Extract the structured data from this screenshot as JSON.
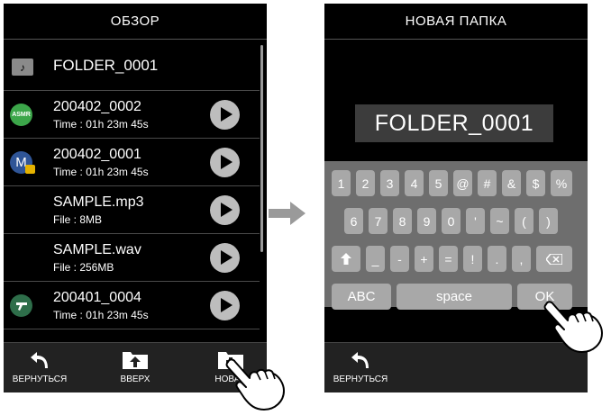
{
  "left": {
    "title": "ОБЗОР",
    "items": [
      {
        "kind": "folder",
        "name": "FOLDER_0001",
        "meta": ""
      },
      {
        "kind": "file",
        "name": "200402_0002",
        "meta": "Time : 01h 23m 45s",
        "icon": "ASMR"
      },
      {
        "kind": "file",
        "name": "200402_0001",
        "meta": "Time : 01h 23m 45s",
        "icon": "M"
      },
      {
        "kind": "file",
        "name": "SAMPLE.mp3",
        "meta": "File : 8MB",
        "icon": ""
      },
      {
        "kind": "file",
        "name": "SAMPLE.wav",
        "meta": "File : 256MB",
        "icon": ""
      },
      {
        "kind": "file",
        "name": "200401_0004",
        "meta": "Time : 01h 23m 45s",
        "icon": ""
      }
    ],
    "bottom": {
      "back": "ВЕРНУТЬСЯ",
      "up": "ВВЕРХ",
      "new": "НОВАЯ"
    }
  },
  "right": {
    "title": "НОВАЯ ПАПКА",
    "folder_name": "FOLDER_0001",
    "keys_row1": [
      "1",
      "2",
      "3",
      "4",
      "5",
      "@",
      "#",
      "&",
      "$",
      "%"
    ],
    "keys_row2": [
      "6",
      "7",
      "8",
      "9",
      "0",
      "'",
      "~",
      "(",
      ")"
    ],
    "keys_row3": [
      "_",
      "-",
      "+",
      "=",
      "!",
      ".",
      ","
    ],
    "abc": "ABC",
    "space": "space",
    "ok": "OK",
    "bottom": {
      "back": "ВЕРНУТЬСЯ"
    }
  },
  "icons": {
    "folder": "folder-icon",
    "play": "play-icon",
    "back": "back-arrow-icon",
    "up": "folder-up-icon",
    "new": "new-folder-icon",
    "shift": "shift-icon",
    "backspace": "backspace-icon",
    "hand": "pointing-hand-icon",
    "arrow": "right-arrow-icon",
    "lock": "lock-icon"
  },
  "colors": {
    "screen_bg": "#000000",
    "keyboard_bg": "#6e6e6e",
    "key_bg": "#a8a8a8",
    "asmr_icon": "#3ca64a",
    "m_icon": "#2f5597",
    "t_icon": "#2e6e4a",
    "lock": "#e5b200"
  }
}
